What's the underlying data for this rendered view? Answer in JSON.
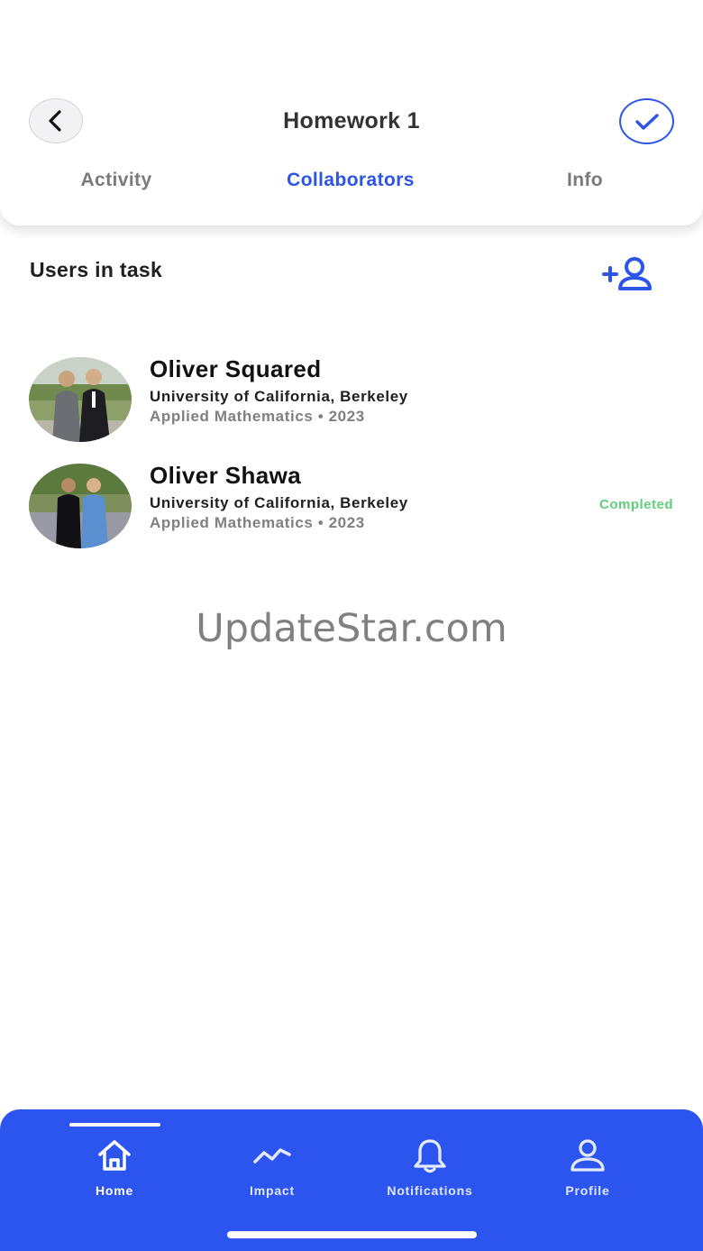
{
  "header": {
    "title": "Homework 1",
    "back_icon": "chevron-left-icon",
    "confirm_icon": "check-icon",
    "tabs": [
      {
        "label": "Activity",
        "active": false
      },
      {
        "label": "Collaborators",
        "active": true
      },
      {
        "label": "Info",
        "active": false
      }
    ]
  },
  "section": {
    "title": "Users in task",
    "add_icon": "add-user-icon"
  },
  "users": [
    {
      "name": "Oliver Squared",
      "school": "University of California, Berkeley",
      "major": "Applied Mathematics • 2023",
      "status": ""
    },
    {
      "name": "Oliver Shawa",
      "school": "University of California, Berkeley",
      "major": "Applied Mathematics • 2023",
      "status": "Completed"
    }
  ],
  "watermark": "UpdateStar.com",
  "nav": {
    "items": [
      {
        "label": "Home",
        "icon": "home-icon",
        "active": true
      },
      {
        "label": "Impact",
        "icon": "trend-line-icon",
        "active": false
      },
      {
        "label": "Notifications",
        "icon": "bell-icon",
        "active": false
      },
      {
        "label": "Profile",
        "icon": "person-icon",
        "active": false
      }
    ]
  },
  "colors": {
    "accent": "#2c55f0",
    "status_completed": "#5fd07a",
    "muted_text": "#7a7a7e"
  }
}
